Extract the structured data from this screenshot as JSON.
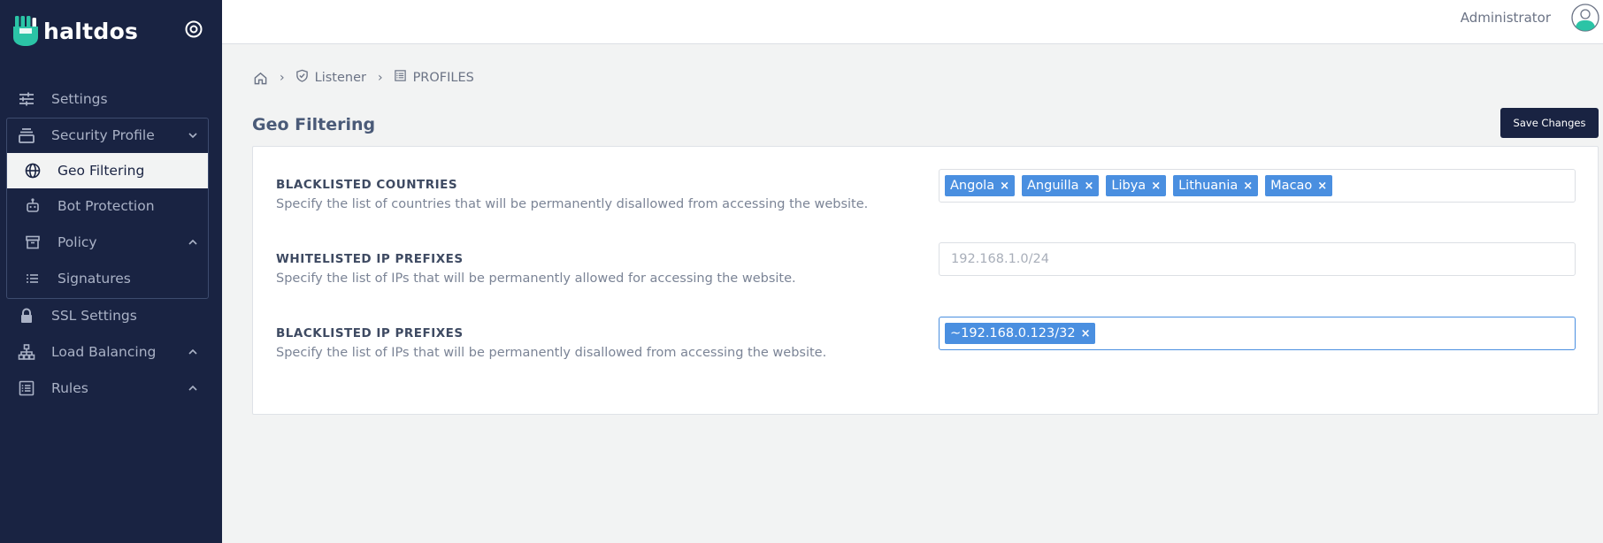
{
  "brand": {
    "name": "haltdos"
  },
  "colors": {
    "sidebar_bg": "#192342",
    "accent": "#4a8fe0",
    "logo": "#2bc4a6",
    "button_bg": "#192342"
  },
  "sidebar": {
    "items": [
      {
        "label": "Settings",
        "icon": "sliders-icon"
      },
      {
        "label": "Security Profile",
        "icon": "layers-icon",
        "expanded": true
      },
      {
        "label": "SSL Settings",
        "icon": "lock-icon"
      },
      {
        "label": "Load Balancing",
        "icon": "sitemap-icon"
      },
      {
        "label": "Rules",
        "icon": "list-box-icon"
      }
    ],
    "sub_items": [
      {
        "label": "Geo Filtering",
        "icon": "globe-icon",
        "active": true
      },
      {
        "label": "Bot Protection",
        "icon": "robot-icon"
      },
      {
        "label": "Policy",
        "icon": "archive-icon"
      },
      {
        "label": "Signatures",
        "icon": "list-icon"
      }
    ]
  },
  "topbar": {
    "user": "Administrator"
  },
  "breadcrumb": {
    "items": [
      "Listener",
      "PROFILES"
    ]
  },
  "page": {
    "title": "Geo Filtering",
    "save_label": "Save Changes"
  },
  "settings": {
    "blacklisted_countries": {
      "title": "BLACKLISTED COUNTRIES",
      "description": "Specify the list of countries that will be permanently disallowed from accessing the website.",
      "tags": [
        "Angola",
        "Anguilla",
        "Libya",
        "Lithuania",
        "Macao"
      ],
      "remove_symbol": "×"
    },
    "whitelisted_ip": {
      "title": "WHITELISTED IP PREFIXES",
      "description": "Specify the list of IPs that will be permanently allowed for accessing the website.",
      "placeholder": "192.168.1.0/24"
    },
    "blacklisted_ip": {
      "title": "BLACKLISTED IP PREFIXES",
      "description": "Specify the list of IPs that will be permanently disallowed from accessing the website.",
      "tags": [
        "~192.168.0.123/32"
      ],
      "remove_symbol": "×"
    }
  }
}
